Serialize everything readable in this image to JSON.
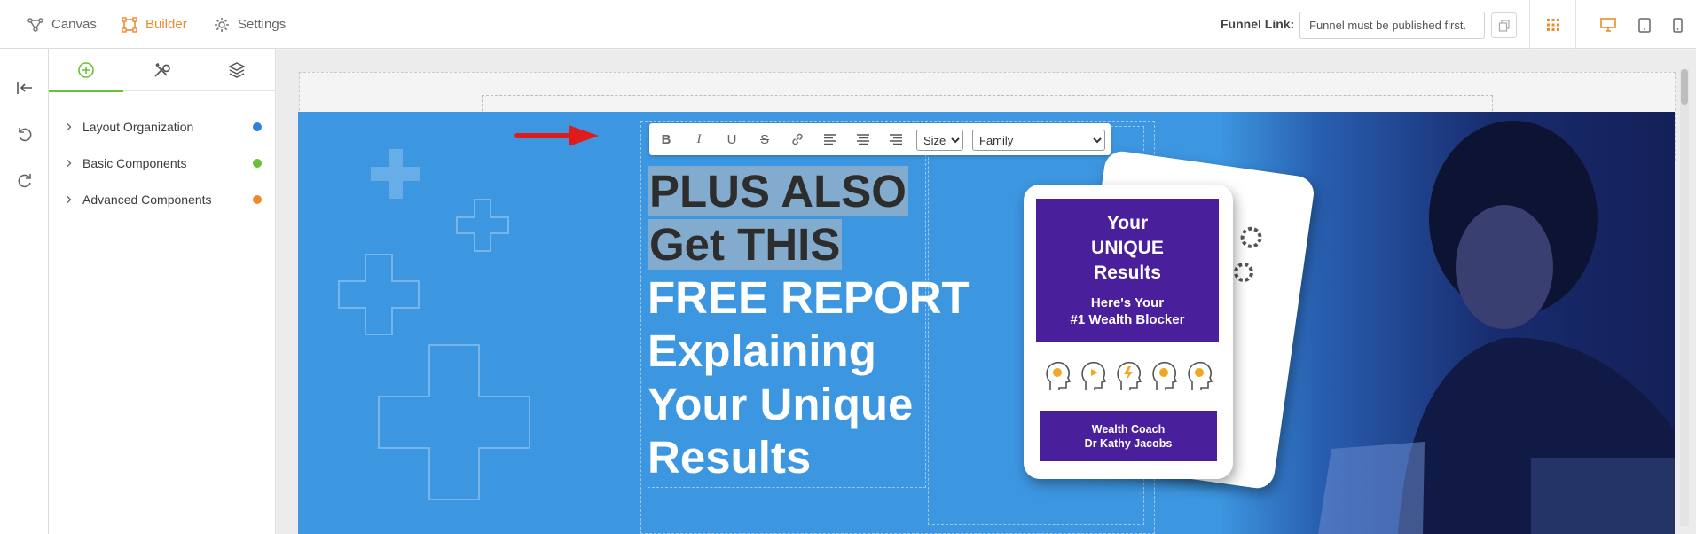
{
  "topbar": {
    "nav": [
      {
        "label": "Canvas",
        "icon": "canvas-icon",
        "active": false
      },
      {
        "label": "Builder",
        "icon": "builder-icon",
        "active": true
      },
      {
        "label": "Settings",
        "icon": "gear-icon",
        "active": false
      }
    ],
    "funnel_link_label": "Funnel Link:",
    "funnel_link_value": "Funnel must be published first.",
    "accent": "#ef8a2a"
  },
  "panel": {
    "tabs": [
      "add-element-icon",
      "tools-icon",
      "layers-icon"
    ],
    "items": [
      {
        "label": "Layout Organization",
        "dot": "#2f80e0"
      },
      {
        "label": "Basic Components",
        "dot": "#6cbf3a"
      },
      {
        "label": "Advanced Components",
        "dot": "#ef8a2a"
      }
    ]
  },
  "toolbar": {
    "bold": "B",
    "italic": "I",
    "underline": "U",
    "strike": "S",
    "size_label": "Size",
    "family_label": "Family"
  },
  "hero": {
    "headline_highlight_1": "PLUS ALSO",
    "headline_highlight_2": "Get THIS",
    "headline_rest": [
      "FREE REPORT",
      "Explaining",
      "Your Unique",
      "Results"
    ],
    "bg": "#3d96e0"
  },
  "book": {
    "title_lines": [
      "Your",
      "UNIQUE",
      "Results"
    ],
    "sub_lines": [
      "Here's Your",
      "#1 Wealth Blocker"
    ],
    "author_lines": [
      "Wealth Coach",
      "Dr Kathy Jacobs"
    ],
    "cover_color": "#4a1f9c"
  }
}
